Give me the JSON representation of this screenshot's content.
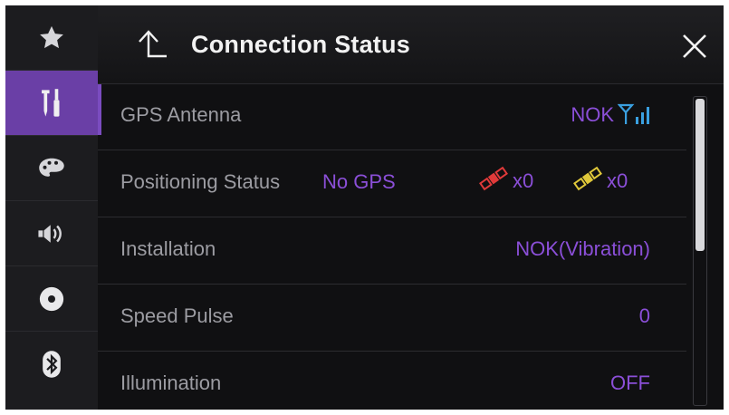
{
  "header": {
    "title": "Connection Status"
  },
  "sidebar": {
    "items": [
      {
        "name": "favorites",
        "icon": "star-icon"
      },
      {
        "name": "system",
        "icon": "tools-icon",
        "active": true
      },
      {
        "name": "theme",
        "icon": "palette-icon"
      },
      {
        "name": "audio",
        "icon": "speaker-icon"
      },
      {
        "name": "av-source",
        "icon": "disc-icon"
      },
      {
        "name": "bluetooth",
        "icon": "bluetooth-icon"
      }
    ]
  },
  "rows": {
    "gps_antenna": {
      "label": "GPS Antenna",
      "value": "NOK"
    },
    "positioning": {
      "label": "Positioning Status",
      "value": "No GPS",
      "sat_red_count": "x0",
      "sat_yellow_count": "x0"
    },
    "installation": {
      "label": "Installation",
      "value": "NOK(Vibration)"
    },
    "speed_pulse": {
      "label": "Speed Pulse",
      "value": "0"
    },
    "illumination": {
      "label": "Illumination",
      "value": "OFF"
    }
  },
  "colors": {
    "accent": "#8b4fd8",
    "active_tab": "#6a3fa6",
    "antenna_icon": "#3aa0e0",
    "sat_red": "#e03a3a",
    "sat_yellow": "#e0c83a"
  },
  "scroll": {
    "visible_fraction": 0.5,
    "position": 0.0
  }
}
